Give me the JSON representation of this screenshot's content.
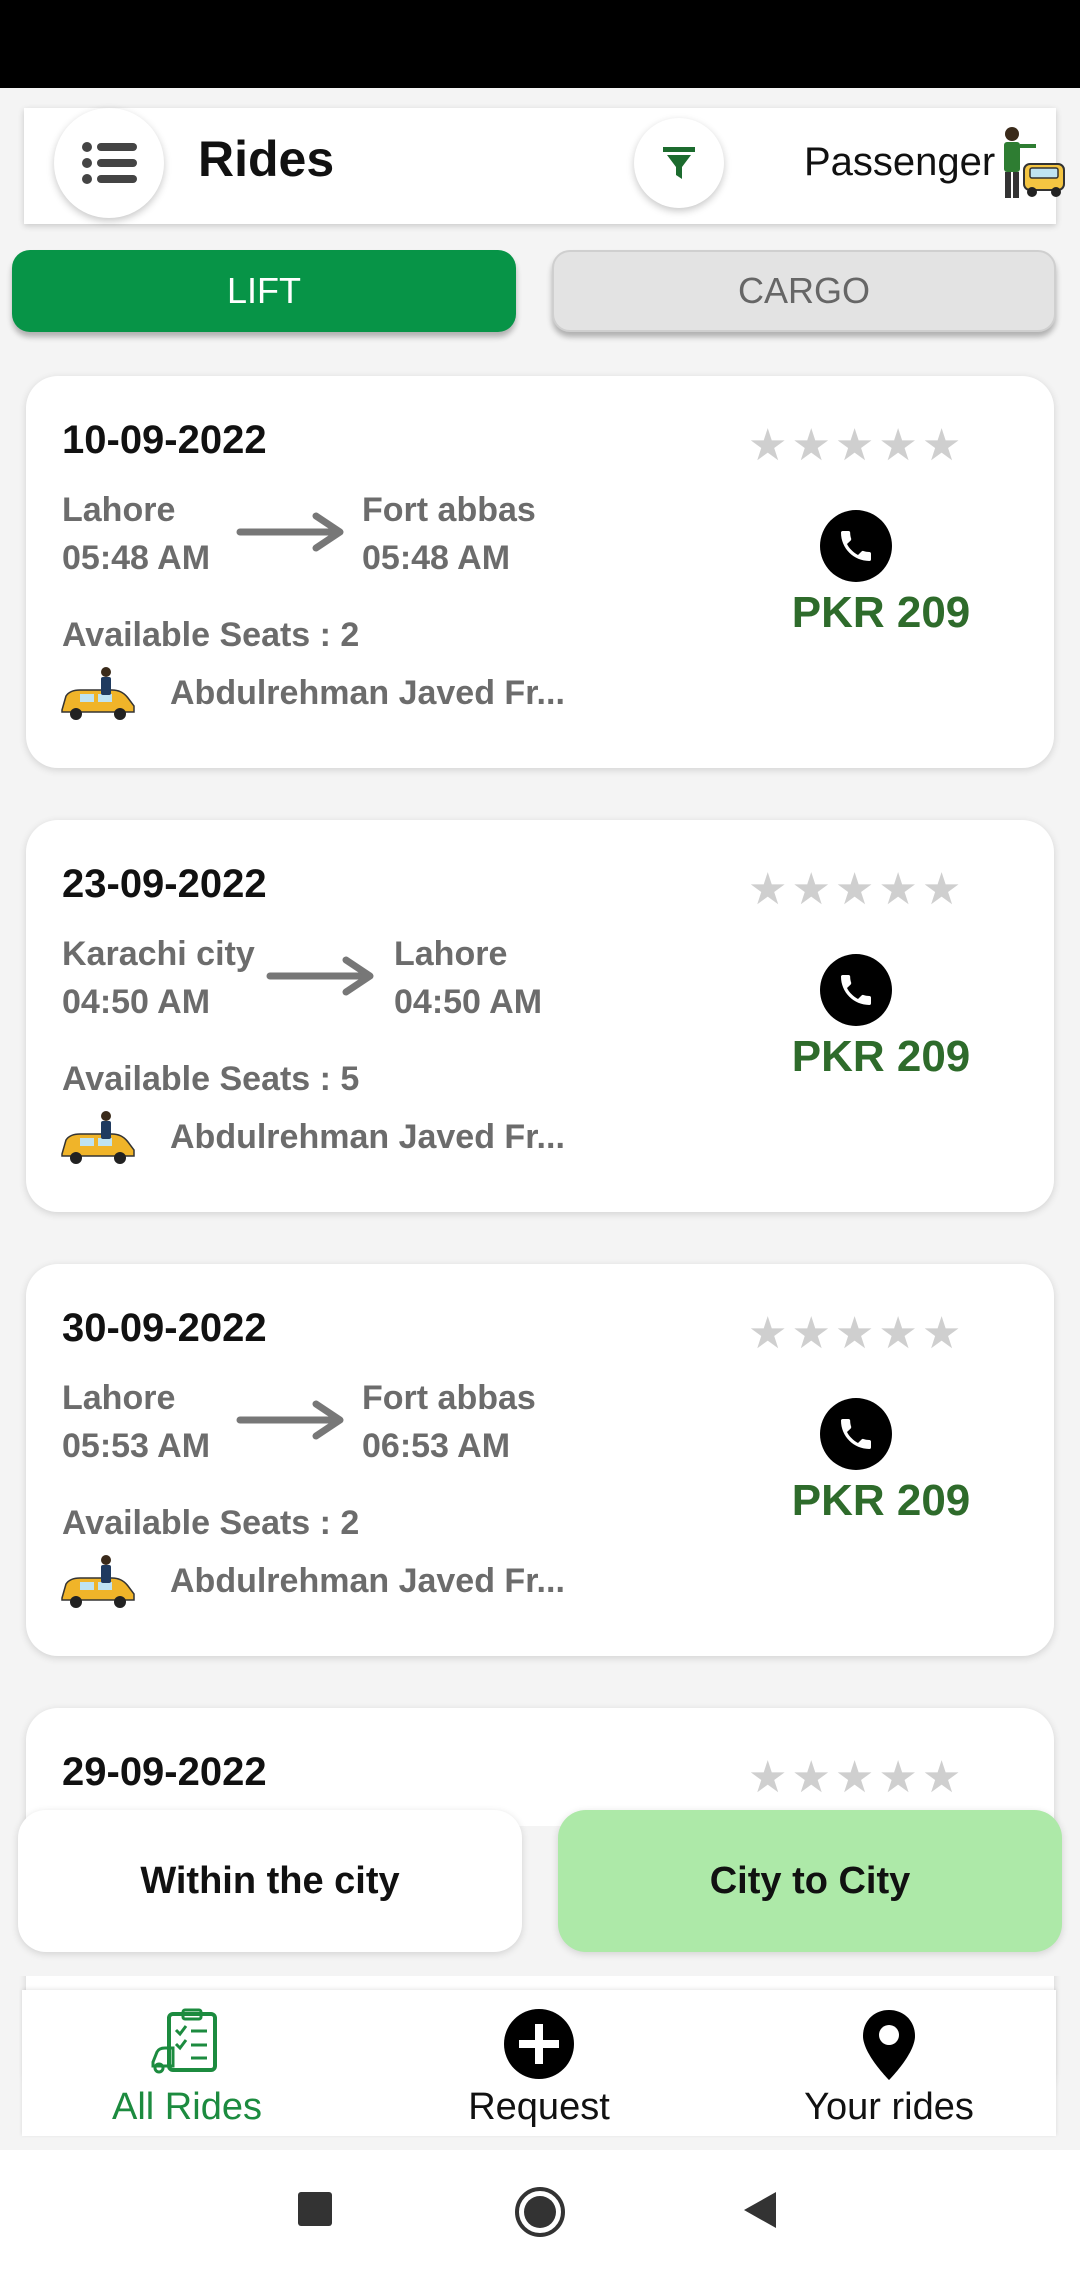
{
  "header": {
    "title": "Rides",
    "role": "Passenger",
    "menu_icon": "list-menu-icon",
    "filter_icon": "filter-icon",
    "role_icon": "passenger-taxi-icon"
  },
  "tabs": [
    {
      "label": "LIFT",
      "active": true
    },
    {
      "label": "CARGO",
      "active": false
    }
  ],
  "rides": [
    {
      "date": "10-09-2022",
      "from": "Lahore",
      "from_time": "05:48 AM",
      "to": "Fort abbas",
      "to_time": "05:48 AM",
      "seats": "Available Seats : 2",
      "driver": "Abdulrehman Javed Fr...",
      "price": "PKR 209",
      "rating": 0
    },
    {
      "date": "23-09-2022",
      "from": "Karachi city",
      "from_time": "04:50 AM",
      "to": "Lahore",
      "to_time": "04:50 AM",
      "seats": "Available Seats : 5",
      "driver": "Abdulrehman Javed Fr...",
      "price": "PKR 209",
      "rating": 0
    },
    {
      "date": "30-09-2022",
      "from": "Lahore",
      "from_time": "05:53 AM",
      "to": "Fort abbas",
      "to_time": "06:53 AM",
      "seats": "Available Seats : 2",
      "driver": "Abdulrehman Javed Fr...",
      "price": "PKR 209",
      "rating": 0
    },
    {
      "date": "29-09-2022",
      "rating": 0
    }
  ],
  "scope": {
    "within": "Within the city",
    "city_to_city": "City to City",
    "selected": "City to City"
  },
  "bottom_nav": [
    {
      "label": "All Rides",
      "icon": "clipboard-list-icon",
      "active": true
    },
    {
      "label": "Request",
      "icon": "add-circle-icon",
      "active": false
    },
    {
      "label": "Your rides",
      "icon": "location-pin-icon",
      "active": false
    }
  ],
  "colors": {
    "primary_green": "#079447",
    "price_green": "#2e6b2b",
    "selected_scope": "#ade9a8",
    "star_inactive": "#cfcfcf"
  }
}
